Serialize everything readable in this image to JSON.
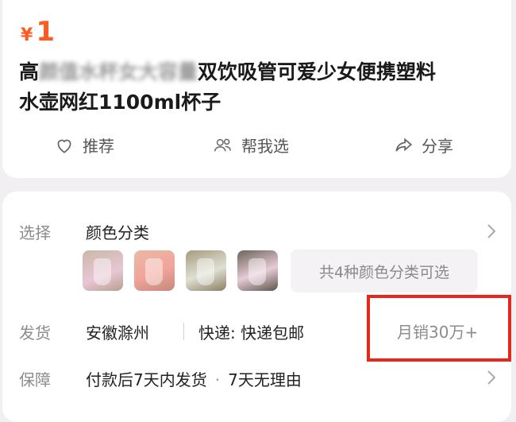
{
  "product": {
    "price_symbol": "¥",
    "price_value": "1",
    "title_line1_prefix": "高",
    "title_line1_blur": "颜值水杯女大容量",
    "title_line1_suffix": "双饮吸管可爱少女便携塑料",
    "title_line2": "水壶网红1100ml杯子"
  },
  "actions": {
    "recommend": "推荐",
    "help_choose": "帮我选",
    "share": "分享"
  },
  "selection": {
    "label": "选择",
    "value": "颜色分类",
    "variant_count_text": "共4种颜色分类可选"
  },
  "shipping": {
    "label": "发货",
    "origin": "安徽滁州",
    "express": "快递: 快递包邮",
    "monthly_sales": "月销30万+"
  },
  "guarantee": {
    "label": "保障",
    "item1": "付款后7天内发货",
    "separator": "·",
    "item2": "7天无理由"
  },
  "colors": {
    "price": "#ff5a1f",
    "highlight_box": "#e8261a",
    "card": "#ffffff",
    "background": "#f2eff3"
  }
}
